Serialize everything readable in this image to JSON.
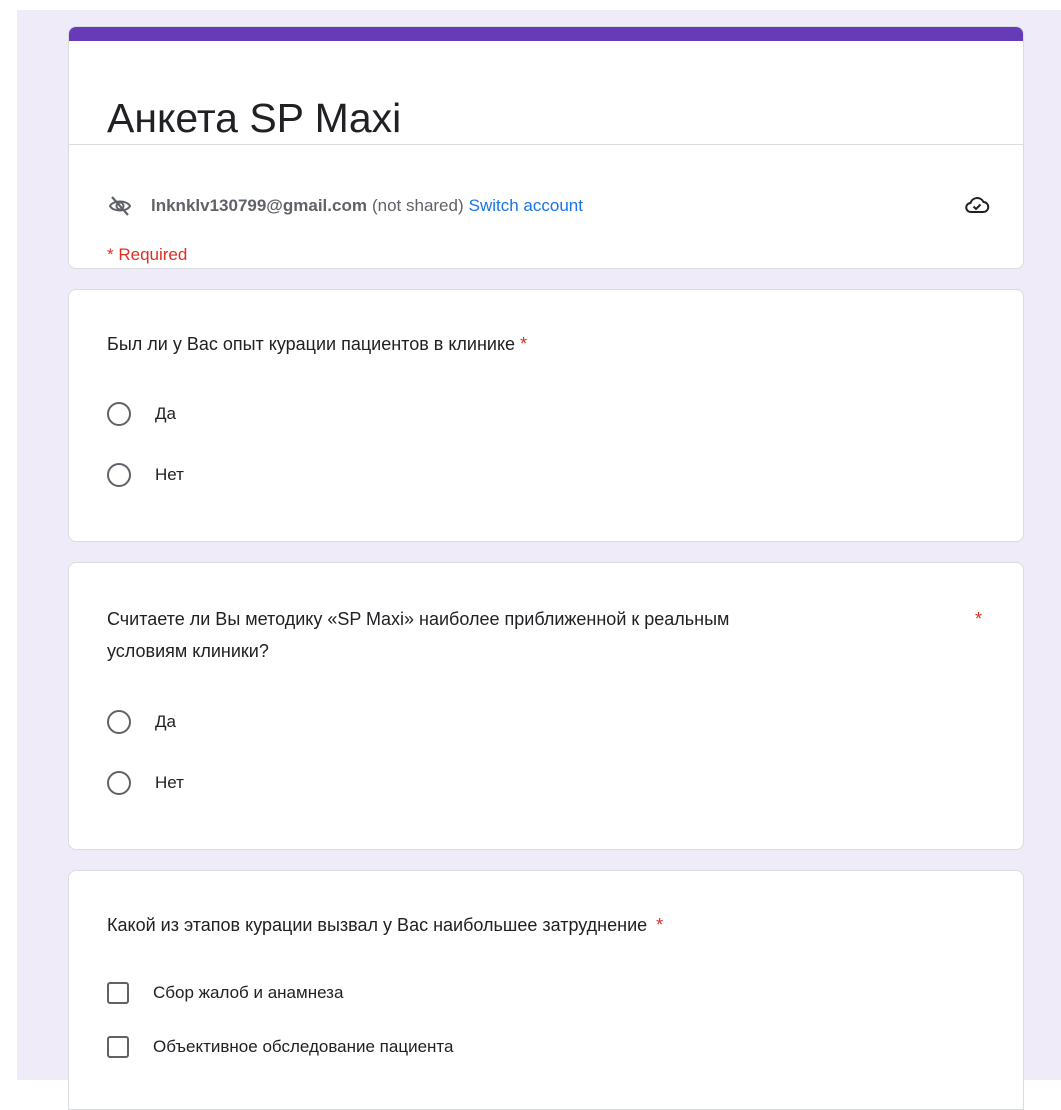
{
  "form": {
    "title": "Анкета SP Maxi",
    "account": {
      "email": "lnknklv130799@gmail.com",
      "status": "(not shared)",
      "switch_label": "Switch account"
    },
    "required_note": "* Required"
  },
  "questions": [
    {
      "text": "Был ли у Вас опыт курации пациентов в клинике",
      "required_mark": "*",
      "type": "radio",
      "options": [
        "Да",
        "Нет"
      ]
    },
    {
      "text_line1": "Считаете ли Вы методику «SP Maxi» наиболее приближенной к реальным",
      "text_line2": "условиям клиники?",
      "required_mark": "*",
      "type": "radio",
      "options": [
        "Да",
        "Нет"
      ]
    },
    {
      "text": "Какой из этапов курации вызвал у Вас наибольшее затруднение",
      "required_mark": "*",
      "type": "checkbox",
      "options": [
        "Сбор жалоб и анамнеза",
        "Объективное обследование пациента"
      ]
    }
  ],
  "colors": {
    "accent": "#673ab7",
    "page_bg": "#f0ebf8",
    "required": "#d93025",
    "link": "#1a73e8"
  },
  "icons": [
    "eye-off-icon",
    "cloud-check-icon"
  ]
}
